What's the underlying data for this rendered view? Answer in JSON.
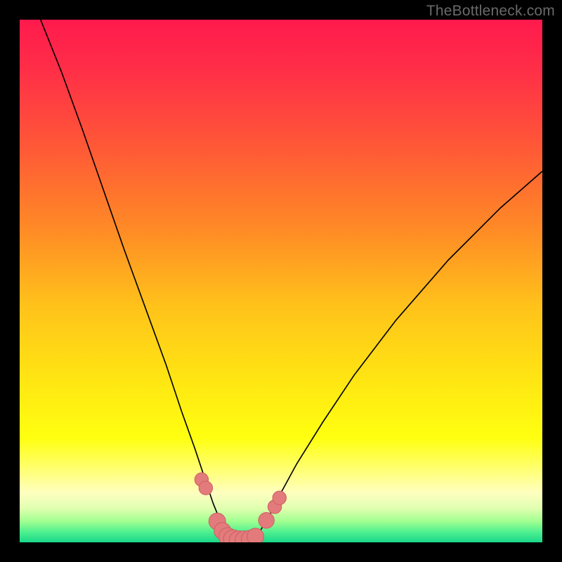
{
  "watermark": "TheBottleneck.com",
  "colors": {
    "black": "#000000",
    "curve_stroke": "#000000",
    "marker_fill": "#e37b7c",
    "marker_stroke": "#cf6264"
  },
  "chart_data": {
    "type": "line",
    "title": "",
    "xlabel": "",
    "ylabel": "",
    "xlim": [
      0,
      100
    ],
    "ylim": [
      0,
      100
    ],
    "gradient_stops": [
      {
        "offset": 0.0,
        "color": "#ff1a4d"
      },
      {
        "offset": 0.1,
        "color": "#ff2f47"
      },
      {
        "offset": 0.25,
        "color": "#ff5a36"
      },
      {
        "offset": 0.4,
        "color": "#ff8a26"
      },
      {
        "offset": 0.55,
        "color": "#ffc31a"
      },
      {
        "offset": 0.7,
        "color": "#ffe812"
      },
      {
        "offset": 0.8,
        "color": "#ffff10"
      },
      {
        "offset": 0.865,
        "color": "#ffff7a"
      },
      {
        "offset": 0.905,
        "color": "#ffffc0"
      },
      {
        "offset": 0.935,
        "color": "#e0ffb0"
      },
      {
        "offset": 0.96,
        "color": "#a0ff90"
      },
      {
        "offset": 0.98,
        "color": "#50f090"
      },
      {
        "offset": 1.0,
        "color": "#18d88a"
      }
    ],
    "series": [
      {
        "name": "left-curve",
        "x": [
          4,
          8,
          12,
          16,
          20,
          24,
          28,
          31,
          33.5,
          35.5,
          37,
          38.3,
          39.3,
          40,
          40.6
        ],
        "y": [
          100,
          90,
          79,
          67.5,
          56,
          45,
          34,
          25,
          18,
          12,
          7.5,
          4.3,
          2.3,
          1.0,
          0.2
        ]
      },
      {
        "name": "right-curve",
        "x": [
          44.5,
          45.2,
          46.2,
          47.7,
          50,
          53,
          58,
          64,
          72,
          82,
          92,
          100
        ],
        "y": [
          0.2,
          1.0,
          2.5,
          5,
          9.5,
          15,
          23,
          32,
          42.5,
          54,
          64,
          71
        ]
      }
    ],
    "markers": {
      "name": "bottom-markers",
      "points": [
        {
          "x": 34.8,
          "y": 12.0,
          "r": 1.3
        },
        {
          "x": 35.6,
          "y": 10.4,
          "r": 1.3
        },
        {
          "x": 37.8,
          "y": 4.0,
          "r": 1.6
        },
        {
          "x": 38.8,
          "y": 2.2,
          "r": 1.6
        },
        {
          "x": 39.8,
          "y": 1.1,
          "r": 1.7
        },
        {
          "x": 40.8,
          "y": 0.6,
          "r": 1.8
        },
        {
          "x": 41.9,
          "y": 0.4,
          "r": 1.8
        },
        {
          "x": 43.0,
          "y": 0.4,
          "r": 1.8
        },
        {
          "x": 44.1,
          "y": 0.6,
          "r": 1.7
        },
        {
          "x": 45.1,
          "y": 1.1,
          "r": 1.6
        },
        {
          "x": 47.2,
          "y": 4.2,
          "r": 1.5
        },
        {
          "x": 48.8,
          "y": 6.8,
          "r": 1.3
        },
        {
          "x": 49.7,
          "y": 8.5,
          "r": 1.3
        }
      ]
    }
  }
}
